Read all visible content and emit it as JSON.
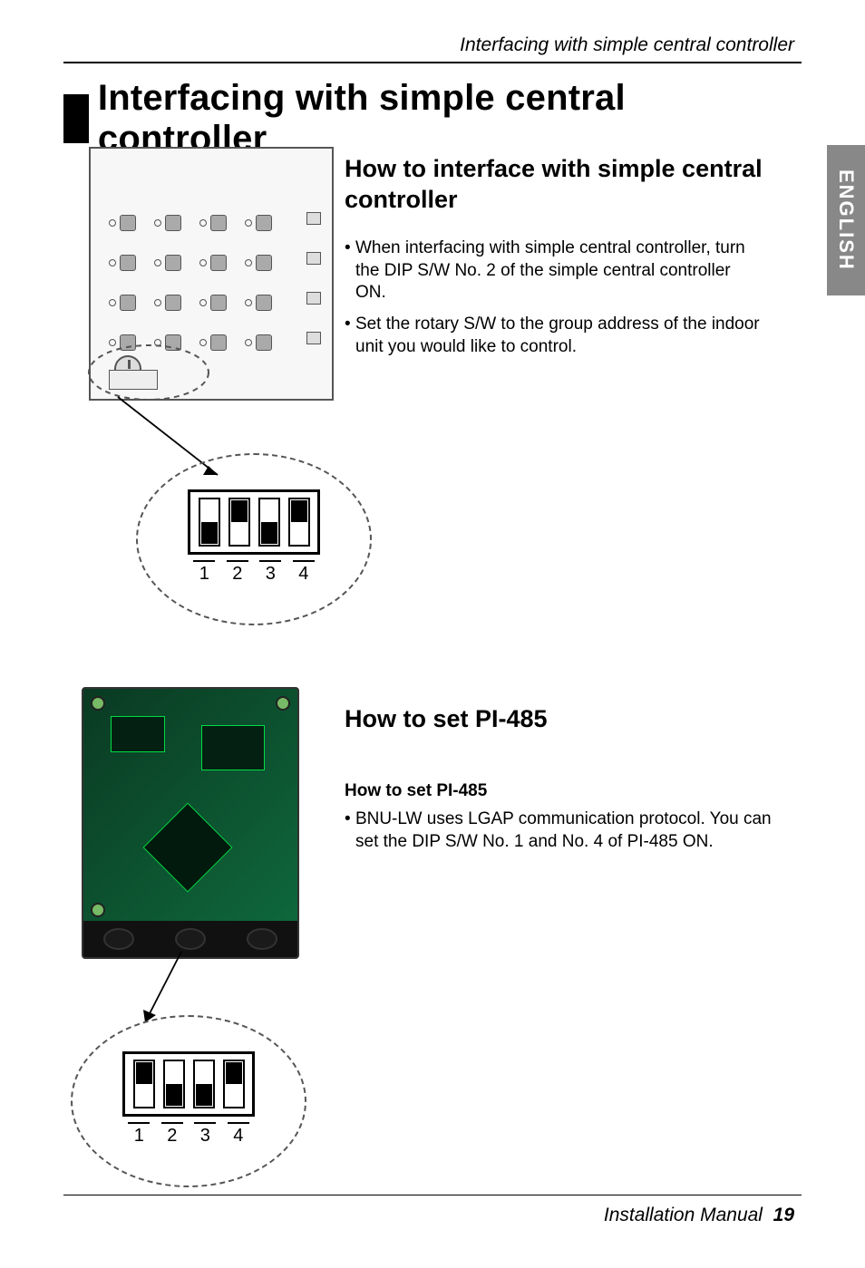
{
  "running_head": "Interfacing with simple central controller",
  "side_tab": "ENGLISH",
  "title": "Interfacing with simple central controller",
  "section1": {
    "heading": "How to interface with simple central controller",
    "bullets": [
      "When interfacing with simple central controller, turn the DIP S/W No. 2 of the simple central controller ON.",
      "Set the rotary S/W to the group address of the indoor unit you would like to control."
    ],
    "dip_switch": {
      "labels": [
        "1",
        "2",
        "3",
        "4"
      ],
      "on": [
        false,
        true,
        false,
        true
      ]
    }
  },
  "section2": {
    "heading": "How to set PI-485",
    "subheading": "How to set PI-485",
    "bullets": [
      "BNU-LW uses LGAP communication protocol. You can set the DIP S/W No. 1 and No. 4 of PI-485 ON."
    ],
    "dip_switch": {
      "labels": [
        "1",
        "2",
        "3",
        "4"
      ],
      "on": [
        true,
        false,
        false,
        true
      ]
    }
  },
  "footer": {
    "text": "Installation Manual",
    "page": "19"
  }
}
